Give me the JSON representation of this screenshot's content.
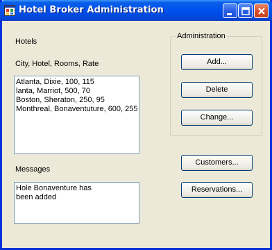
{
  "window": {
    "title": "Hotel Broker Administration"
  },
  "hotels": {
    "heading": "Hotels",
    "columns_label": "City, Hotel, Rooms, Rate",
    "items": [
      "Atlanta, Dixie, 100, 115",
      "lanta, Marriot, 500, 70",
      "Boston, Sheraton, 250, 95",
      "Monthreal, Bonaventuture, 600, 255"
    ]
  },
  "messages": {
    "heading": "Messages",
    "text": "Hole Bonaventure has been added"
  },
  "administration": {
    "group_label": "Administration",
    "add_label": "Add...",
    "delete_label": "Delete",
    "change_label": "Change..."
  },
  "buttons": {
    "customers_label": "Customers...",
    "reservations_label": "Reservations..."
  },
  "icons": {
    "app": "app-window-icon",
    "minimize": "minimize-icon",
    "maximize": "maximize-icon",
    "close": "close-icon"
  }
}
